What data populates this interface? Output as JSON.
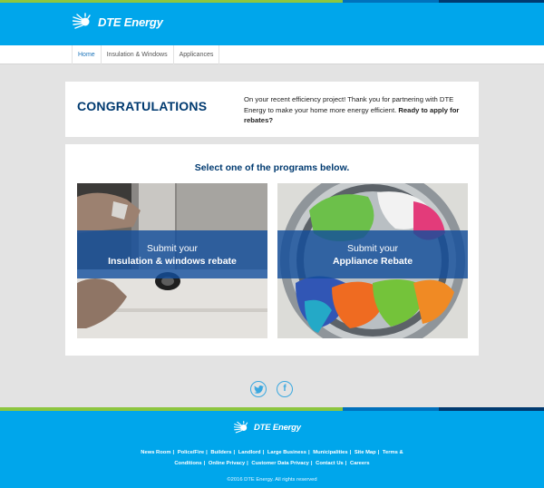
{
  "header": {
    "logo_text": "DTE Energy",
    "logo_icon": "dte-sun-icon"
  },
  "nav": {
    "items": [
      {
        "label": "Home",
        "active": true
      },
      {
        "label": "Insulation & Windows",
        "active": false
      },
      {
        "label": "Applicances",
        "active": false
      }
    ]
  },
  "congrats": {
    "heading": "CONGRATULATIONS",
    "text": "On your recent efficiency project! Thank you for partnering with DTE Energy to make your home more energy efficient.",
    "text_bold": "Ready to apply for rebates?"
  },
  "programs": {
    "title": "Select one of the programs below.",
    "cards": [
      {
        "line1": "Submit your",
        "line2": "Insulation & windows rebate",
        "image": "window-caulking-photo"
      },
      {
        "line1": "Submit your",
        "line2": "Appliance Rebate",
        "image": "washing-machine-photo"
      }
    ]
  },
  "social": {
    "twitter_icon": "twitter-icon",
    "facebook_icon": "facebook-icon",
    "facebook_glyph": "f"
  },
  "footer": {
    "logo_text": "DTE Energy",
    "links": [
      "News Room",
      "Police/Fire",
      "Builders",
      "Landlord",
      "Large Business",
      "Municipalities",
      "Site Map",
      "Terms & Conditions",
      "Online Privacy",
      "Customer Data Privacy",
      "Contact Us",
      "Careers"
    ],
    "copyright": "©2016 DTE Energy. All rights reserved"
  },
  "colors": {
    "brand_blue": "#00a6eb",
    "navy": "#003a70",
    "green": "#8dc63f",
    "banner_blue": "#144e9b"
  }
}
